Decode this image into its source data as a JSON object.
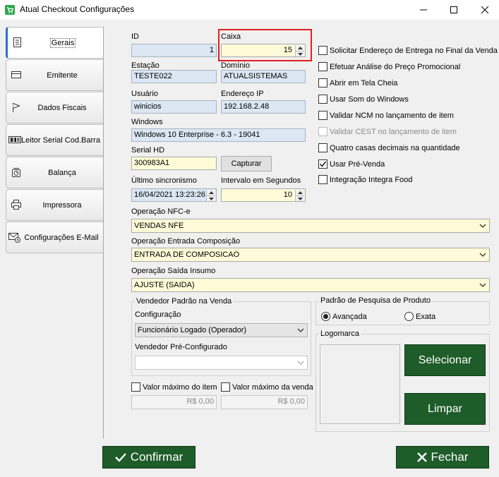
{
  "window": {
    "title": "Atual Checkout Configurações",
    "icon": "cart-icon"
  },
  "tabs": [
    {
      "label": "Gerais",
      "icon": "document-icon",
      "active": true
    },
    {
      "label": "Emitente",
      "icon": "card-icon",
      "active": false
    },
    {
      "label": "Dados Fiscais",
      "icon": "flag-icon",
      "active": false
    },
    {
      "label": "Leitor Serial Cod.Barra",
      "icon": "barcode-icon",
      "active": false
    },
    {
      "label": "Balança",
      "icon": "scale-icon",
      "active": false
    },
    {
      "label": "Impressora",
      "icon": "printer-icon",
      "active": false
    },
    {
      "label": "Configurações E-Mail",
      "icon": "email-settings-icon",
      "active": false
    }
  ],
  "fields": {
    "id": {
      "label": "ID",
      "value": "1"
    },
    "caixa": {
      "label": "Caixa",
      "value": "15"
    },
    "estacao": {
      "label": "Estação",
      "value": "TESTE022"
    },
    "dominio": {
      "label": "Domínio",
      "value": "ATUALSISTEMAS"
    },
    "usuario": {
      "label": "Usuário",
      "value": "winicios"
    },
    "endereco_ip": {
      "label": "Endereço IP",
      "value": "192.168.2.48"
    },
    "windows": {
      "label": "Windows",
      "value": "Windows 10 Enterprise - 6.3 - 19041"
    },
    "serial_hd": {
      "label": "Serial HD",
      "value": "300983A1"
    },
    "capturar_label": "Capturar",
    "ultimo_sincronismo": {
      "label": "Último sincronismo",
      "value": "16/04/2021 13:23:26"
    },
    "intervalo": {
      "label": "Intervalo em Segundos",
      "value": "10"
    }
  },
  "options": [
    {
      "label": "Solicitar Endereço de Entrega no Final da Venda",
      "checked": false,
      "disabled": false
    },
    {
      "label": "Efetuar Análise do Preço Promocional",
      "checked": false,
      "disabled": false
    },
    {
      "label": "Abrir em Tela Cheia",
      "checked": false,
      "disabled": false
    },
    {
      "label": "Usar Som do Windows",
      "checked": false,
      "disabled": false
    },
    {
      "label": "Validar NCM no lançamento de item",
      "checked": false,
      "disabled": false
    },
    {
      "label": "Validar CEST no lançamento de item",
      "checked": false,
      "disabled": true
    },
    {
      "label": "Quatro casas decimais na quantidade",
      "checked": false,
      "disabled": false
    },
    {
      "label": "Usar Pré-Venda",
      "checked": true,
      "disabled": false
    },
    {
      "label": "Integração Integra Food",
      "checked": false,
      "disabled": false
    }
  ],
  "operacoes": {
    "nfce": {
      "label": "Operação NFC-e",
      "value": "VENDAS NFE"
    },
    "entrada_composicao": {
      "label": "Operação Entrada Composição",
      "value": "ENTRADA DE COMPOSICAO"
    },
    "saida_insumo": {
      "label": "Operação Saída Insumo",
      "value": "AJUSTE (SAIDA)"
    }
  },
  "vendedor": {
    "group_title": "Vendedor Padrão na Venda",
    "configuracao_label": "Configuração",
    "configuracao_value": "Funcionário Logado (Operador)",
    "pre_configurado_label": "Vendedor Pré-Configurado",
    "pre_configurado_value": ""
  },
  "pesquisa": {
    "group_title": "Padrão de Pesquisa de Produto",
    "avancada": "Avançada",
    "exata": "Exata",
    "selected": "Avançada"
  },
  "logomarca": {
    "group_title": "Logomarca",
    "selecionar": "Selecionar",
    "limpar": "Limpar"
  },
  "valores": {
    "item_label": "Valor máximo do item",
    "item_value": "R$ 0,00",
    "venda_label": "Valor máximo da venda",
    "venda_value": "R$ 0,00"
  },
  "footer": {
    "confirmar": "Confirmar",
    "fechar": "Fechar"
  },
  "colors": {
    "button_green": "#1e5c2a",
    "highlight_red": "#e02020",
    "field_blue": "#dbe7f3",
    "field_yellow": "#fffbd8"
  }
}
